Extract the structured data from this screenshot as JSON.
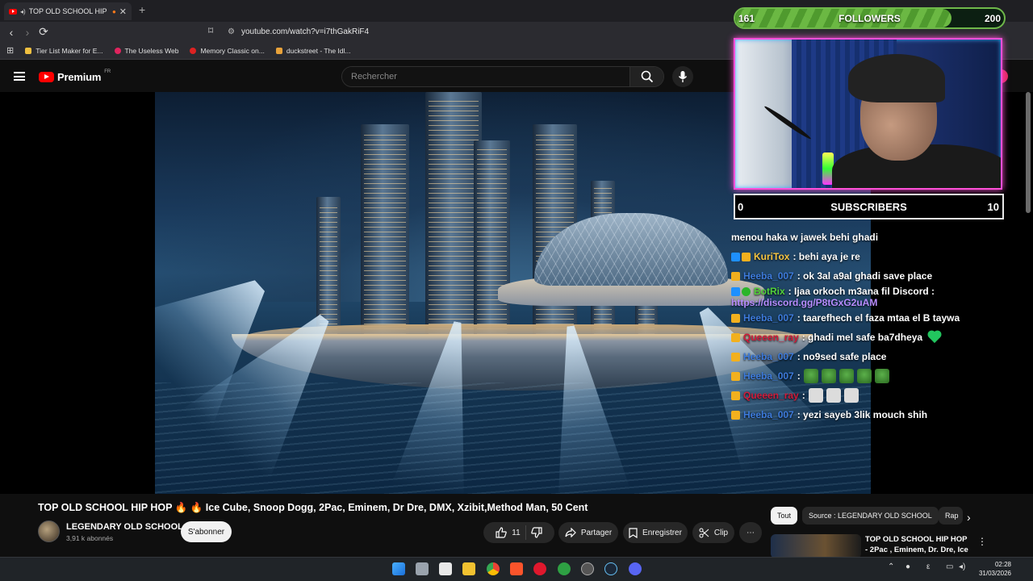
{
  "browser": {
    "tab_title": "TOP OLD SCHOOL HIP HOP",
    "tab_close": "✕",
    "new_tab": "+",
    "url": "youtube.com/watch?v=i7thGakRiF4",
    "bookmarks": [
      {
        "label": "Tier List Maker for E...",
        "color": "#f0c040"
      },
      {
        "label": "The Useless Web",
        "color": "#e0245e"
      },
      {
        "label": "Memory Classic on...",
        "color": "#d22"
      },
      {
        "label": "duckstreet - The Idl...",
        "color": "#e8a23a"
      }
    ]
  },
  "youtube": {
    "logo_text": "Premium",
    "region": "FR",
    "search_placeholder": "Rechercher"
  },
  "video": {
    "title": "TOP OLD SCHOOL HIP HOP 🔥 🔥 Ice Cube, Snoop Dogg, 2Pac, Eminem, Dr Dre, DMX, Xzibit,Method Man, 50 Cent",
    "channel_name": "LEGENDARY OLD SCHOOL",
    "channel_subs": "3,91 k abonnés",
    "subscribe_label": "S'abonner",
    "like_count": "11",
    "share_label": "Partager",
    "save_label": "Enregistrer",
    "clip_label": "Clip",
    "more_label": "⋯"
  },
  "sidebar": {
    "chips": [
      {
        "label": "Tout",
        "active": true
      },
      {
        "label": "Source : LEGENDARY OLD SCHOOL",
        "active": false
      },
      {
        "label": "Rap",
        "active": false
      }
    ],
    "recommendation_title": "TOP OLD SCHOOL HIP HOP - 2Pac , Eminem, Dr. Dre, Ice ..."
  },
  "overlay": {
    "followers": {
      "label": "FOLLOWERS",
      "current": "161",
      "goal": "200",
      "progress": 0.805
    },
    "subscribers": {
      "label": "SUBSCRIBERS",
      "current": "0",
      "goal": "10",
      "progress": 0
    },
    "chat": [
      {
        "badges": [],
        "user": "",
        "user_color": "#ffffff",
        "text": "menou haka w jawek behi ghadi"
      },
      {
        "badges": [
          "vip",
          "crown"
        ],
        "user": "KuriTox",
        "user_color": "#f5c542",
        "text": ": behi aya je re"
      },
      {
        "badges": [
          "crown"
        ],
        "user": "Heeba_007",
        "user_color": "#3d7bdc",
        "text": ": ok 3al a9al ghadi save place"
      },
      {
        "badges": [
          "vip",
          "check"
        ],
        "user": "BotRix",
        "user_color": "#52d13a",
        "text": ": Ijaa orkoch m3ana fil Discord :",
        "link": "https://discord.gg/P8tGxG2uAM"
      },
      {
        "badges": [
          "crown"
        ],
        "user": "Heeba_007",
        "user_color": "#3d7bdc",
        "text": ": taarefhech el faza mtaa el B taywa"
      },
      {
        "badges": [
          "crown"
        ],
        "user": "Queeen_ray",
        "user_color": "#d11a3a",
        "text": ": ghadi mel safe ba7dheya",
        "heart": true
      },
      {
        "badges": [
          "crown"
        ],
        "user": "Heeba_007",
        "user_color": "#3d7bdc",
        "text": ": no9sed safe place"
      },
      {
        "badges": [
          "crown"
        ],
        "user": "Heeba_007",
        "user_color": "#3d7bdc",
        "text": ":",
        "emotes": [
          "frog",
          "frog",
          "frog",
          "frog",
          "frog"
        ]
      },
      {
        "badges": [
          "crown"
        ],
        "user": "Queeen_ray",
        "user_color": "#d11a3a",
        "text": ":",
        "emotes": [
          "ghost",
          "ghost",
          "ghost"
        ]
      },
      {
        "badges": [
          "crown"
        ],
        "user": "Heeba_007",
        "user_color": "#3d7bdc",
        "text": ": yezi sayeb 3lik mouch shih"
      }
    ]
  },
  "taskbar": {
    "time": "02:28",
    "date": "31/03/2026"
  }
}
